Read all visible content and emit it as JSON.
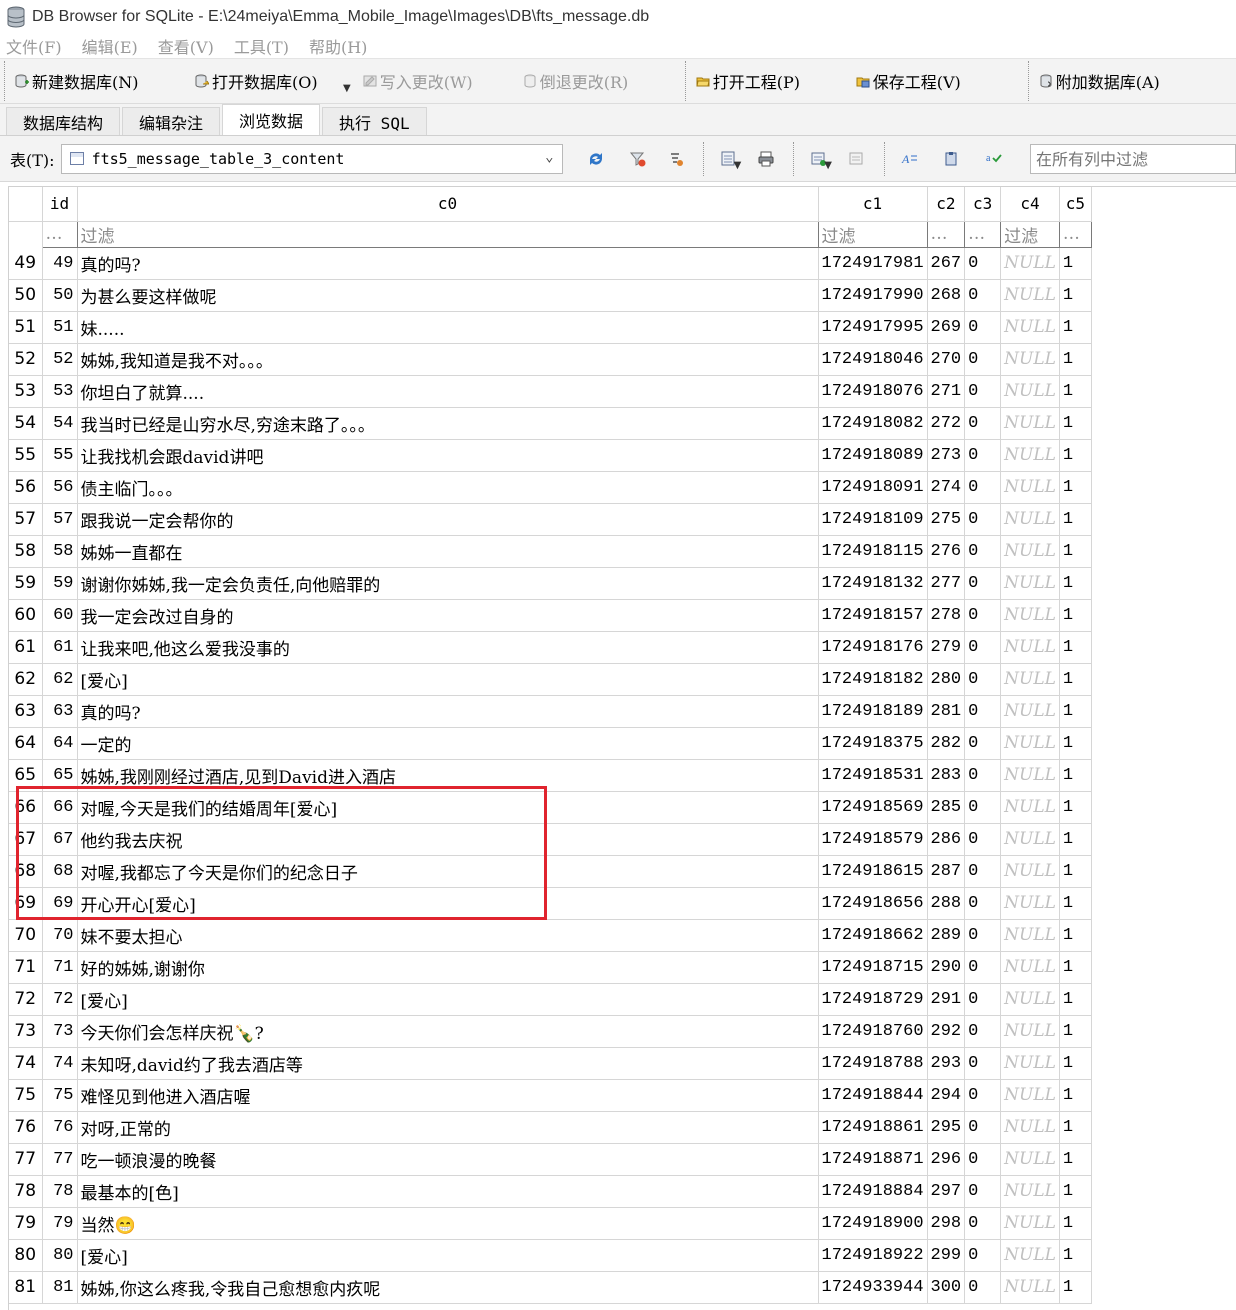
{
  "window": {
    "title": "DB Browser for SQLite - E:\\24meiya\\Emma_Mobile_Image\\Images\\DB\\fts_message.db"
  },
  "menu": [
    "文件(F)",
    "编辑(E)",
    "查看(V)",
    "工具(T)",
    "帮助(H)"
  ],
  "toolbar": {
    "new_db": "新建数据库(N)",
    "open_db": "打开数据库(O)",
    "write_changes": "写入更改(W)",
    "revert_changes": "倒退更改(R)",
    "open_project": "打开工程(P)",
    "save_project": "保存工程(V)",
    "attach_db": "附加数据库(A)"
  },
  "tabs": [
    "数据库结构",
    "编辑杂注",
    "浏览数据",
    "执行 SQL"
  ],
  "active_tab": "浏览数据",
  "browse": {
    "table_label": "表(T):",
    "table_name": "fts5_message_table_3_content",
    "filter_all_placeholder": "在所有列中过滤"
  },
  "grid": {
    "columns": [
      "id",
      "c0",
      "c1",
      "c2",
      "c3",
      "c4",
      "c5"
    ],
    "filter_row": [
      "…",
      "过滤",
      "过滤",
      "…",
      "…",
      "过滤",
      "…"
    ],
    "rows": [
      {
        "n": "49",
        "id": "49",
        "c0": "真的吗?",
        "c1": "1724917981",
        "c2": "267",
        "c3": "0",
        "c4": "NULL",
        "c5": "1"
      },
      {
        "n": "50",
        "id": "50",
        "c0": "为甚么要这样做呢",
        "c1": "1724917990",
        "c2": "268",
        "c3": "0",
        "c4": "NULL",
        "c5": "1"
      },
      {
        "n": "51",
        "id": "51",
        "c0": "妹.....",
        "c1": "1724917995",
        "c2": "269",
        "c3": "0",
        "c4": "NULL",
        "c5": "1"
      },
      {
        "n": "52",
        "id": "52",
        "c0": "姊姊,我知道是我不对。。。",
        "c1": "1724918046",
        "c2": "270",
        "c3": "0",
        "c4": "NULL",
        "c5": "1"
      },
      {
        "n": "53",
        "id": "53",
        "c0": "你坦白了就算....",
        "c1": "1724918076",
        "c2": "271",
        "c3": "0",
        "c4": "NULL",
        "c5": "1"
      },
      {
        "n": "54",
        "id": "54",
        "c0": "我当时已经是山穷水尽,穷途末路了。。。",
        "c1": "1724918082",
        "c2": "272",
        "c3": "0",
        "c4": "NULL",
        "c5": "1"
      },
      {
        "n": "55",
        "id": "55",
        "c0": "让我找机会跟david讲吧",
        "c1": "1724918089",
        "c2": "273",
        "c3": "0",
        "c4": "NULL",
        "c5": "1"
      },
      {
        "n": "56",
        "id": "56",
        "c0": "债主临门。。。",
        "c1": "1724918091",
        "c2": "274",
        "c3": "0",
        "c4": "NULL",
        "c5": "1"
      },
      {
        "n": "57",
        "id": "57",
        "c0": "跟我说一定会帮你的",
        "c1": "1724918109",
        "c2": "275",
        "c3": "0",
        "c4": "NULL",
        "c5": "1"
      },
      {
        "n": "58",
        "id": "58",
        "c0": "姊姊一直都在",
        "c1": "1724918115",
        "c2": "276",
        "c3": "0",
        "c4": "NULL",
        "c5": "1"
      },
      {
        "n": "59",
        "id": "59",
        "c0": "谢谢你姊姊,我一定会负责任,向他赔罪的",
        "c1": "1724918132",
        "c2": "277",
        "c3": "0",
        "c4": "NULL",
        "c5": "1"
      },
      {
        "n": "60",
        "id": "60",
        "c0": "我一定会改过自身的",
        "c1": "1724918157",
        "c2": "278",
        "c3": "0",
        "c4": "NULL",
        "c5": "1"
      },
      {
        "n": "61",
        "id": "61",
        "c0": "让我来吧,他这么爱我没事的",
        "c1": "1724918176",
        "c2": "279",
        "c3": "0",
        "c4": "NULL",
        "c5": "1"
      },
      {
        "n": "62",
        "id": "62",
        "c0": "[爱心]",
        "c1": "1724918182",
        "c2": "280",
        "c3": "0",
        "c4": "NULL",
        "c5": "1"
      },
      {
        "n": "63",
        "id": "63",
        "c0": "真的吗?",
        "c1": "1724918189",
        "c2": "281",
        "c3": "0",
        "c4": "NULL",
        "c5": "1"
      },
      {
        "n": "64",
        "id": "64",
        "c0": "一定的",
        "c1": "1724918375",
        "c2": "282",
        "c3": "0",
        "c4": "NULL",
        "c5": "1"
      },
      {
        "n": "65",
        "id": "65",
        "c0": "姊姊,我刚刚经过酒店,见到David进入酒店",
        "c1": "1724918531",
        "c2": "283",
        "c3": "0",
        "c4": "NULL",
        "c5": "1"
      },
      {
        "n": "66",
        "id": "66",
        "c0": "对喔,今天是我们的结婚周年[爱心]",
        "c1": "1724918569",
        "c2": "285",
        "c3": "0",
        "c4": "NULL",
        "c5": "1"
      },
      {
        "n": "67",
        "id": "67",
        "c0": "他约我去庆祝",
        "c1": "1724918579",
        "c2": "286",
        "c3": "0",
        "c4": "NULL",
        "c5": "1"
      },
      {
        "n": "68",
        "id": "68",
        "c0": "对喔,我都忘了今天是你们的纪念日子",
        "c1": "1724918615",
        "c2": "287",
        "c3": "0",
        "c4": "NULL",
        "c5": "1"
      },
      {
        "n": "69",
        "id": "69",
        "c0": "开心开心[爱心]",
        "c1": "1724918656",
        "c2": "288",
        "c3": "0",
        "c4": "NULL",
        "c5": "1"
      },
      {
        "n": "70",
        "id": "70",
        "c0": "妹不要太担心",
        "c1": "1724918662",
        "c2": "289",
        "c3": "0",
        "c4": "NULL",
        "c5": "1"
      },
      {
        "n": "71",
        "id": "71",
        "c0": "好的姊姊,谢谢你",
        "c1": "1724918715",
        "c2": "290",
        "c3": "0",
        "c4": "NULL",
        "c5": "1"
      },
      {
        "n": "72",
        "id": "72",
        "c0": "[爱心]",
        "c1": "1724918729",
        "c2": "291",
        "c3": "0",
        "c4": "NULL",
        "c5": "1"
      },
      {
        "n": "73",
        "id": "73",
        "c0": "今天你们会怎样庆祝🍾?",
        "c1": "1724918760",
        "c2": "292",
        "c3": "0",
        "c4": "NULL",
        "c5": "1"
      },
      {
        "n": "74",
        "id": "74",
        "c0": "未知呀,david约了我去酒店等",
        "c1": "1724918788",
        "c2": "293",
        "c3": "0",
        "c4": "NULL",
        "c5": "1"
      },
      {
        "n": "75",
        "id": "75",
        "c0": "难怪见到他进入酒店喔",
        "c1": "1724918844",
        "c2": "294",
        "c3": "0",
        "c4": "NULL",
        "c5": "1"
      },
      {
        "n": "76",
        "id": "76",
        "c0": "对呀,正常的",
        "c1": "1724918861",
        "c2": "295",
        "c3": "0",
        "c4": "NULL",
        "c5": "1"
      },
      {
        "n": "77",
        "id": "77",
        "c0": "吃一顿浪漫的晚餐",
        "c1": "1724918871",
        "c2": "296",
        "c3": "0",
        "c4": "NULL",
        "c5": "1"
      },
      {
        "n": "78",
        "id": "78",
        "c0": "最基本的[色]",
        "c1": "1724918884",
        "c2": "297",
        "c3": "0",
        "c4": "NULL",
        "c5": "1"
      },
      {
        "n": "79",
        "id": "79",
        "c0": "当然😁",
        "c1": "1724918900",
        "c2": "298",
        "c3": "0",
        "c4": "NULL",
        "c5": "1"
      },
      {
        "n": "80",
        "id": "80",
        "c0": "[爱心]",
        "c1": "1724918922",
        "c2": "299",
        "c3": "0",
        "c4": "NULL",
        "c5": "1"
      },
      {
        "n": "81",
        "id": "81",
        "c0": "姊姊,你这么疼我,令我自己愈想愈内疚呢",
        "c1": "1724933944",
        "c2": "300",
        "c3": "0",
        "c4": "NULL",
        "c5": "1"
      }
    ]
  },
  "colors": {
    "highlight": "#e0242e",
    "null_text": "#c0c0c0",
    "disabled_text": "#9a9a9a"
  }
}
